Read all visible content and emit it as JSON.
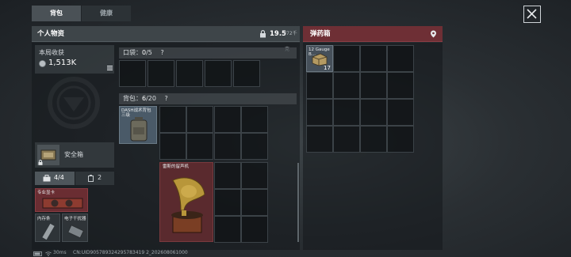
{
  "tabs": [
    {
      "label": "背包",
      "active": true
    },
    {
      "label": "健康",
      "active": false
    }
  ],
  "personal": {
    "title": "个人物资",
    "weight_current": "19.5",
    "weight_max": "/72千克"
  },
  "earnings": {
    "label": "本局收获",
    "value": "1,513K"
  },
  "pocket": {
    "label": "口袋：",
    "count": "0",
    "capacity": "/5",
    "help": "?"
  },
  "backpack": {
    "label": "背包：",
    "count": "6",
    "capacity": "/20",
    "help": "?",
    "item_name": "DASH战术背包",
    "item_sub": "三级",
    "gramophone_label": "雷斯的留声机"
  },
  "safe_box": {
    "label": "安全箱"
  },
  "quick_tabs": [
    {
      "label": "4/4"
    },
    {
      "label": "2"
    }
  ],
  "quick_items": [
    {
      "label": "专业显卡"
    },
    {
      "label": "内存条"
    },
    {
      "label": "电子干扰器"
    }
  ],
  "ammo_box": {
    "title": "弹药箱",
    "item_name": "12 Gauge",
    "item_sub": "B...",
    "item_count": "17"
  },
  "status_bar": {
    "ping": "30ms",
    "uid": "CN:UID905789324295783419 2_202608061000"
  },
  "colors": {
    "ammo_header": "#6e2f35",
    "highlight_item": "#5a2a2e",
    "panel_header": "#3e4549"
  }
}
